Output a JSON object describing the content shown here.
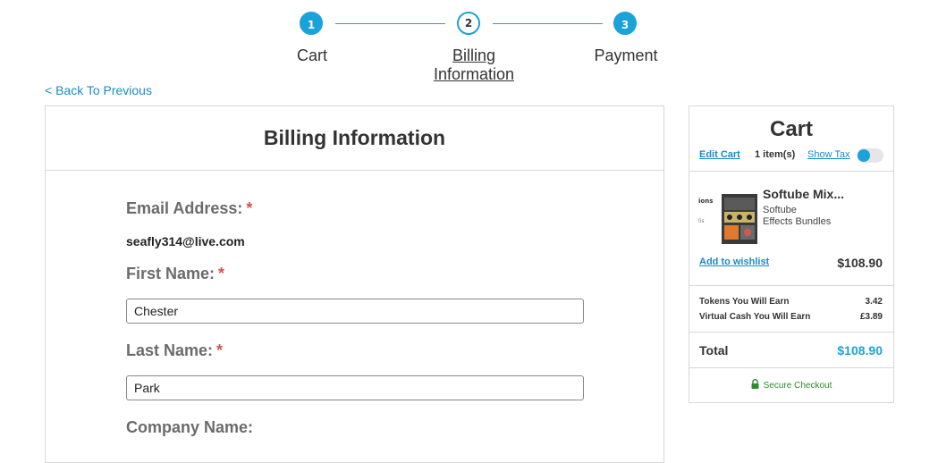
{
  "stepper": {
    "steps": [
      {
        "number": "1",
        "label": "Cart"
      },
      {
        "number": "2",
        "label_line1": "Billing",
        "label_line2": "Information"
      },
      {
        "number": "3",
        "label": "Payment"
      }
    ],
    "current_step": 2
  },
  "back_link": "< Back To Previous",
  "billing": {
    "title": "Billing Information",
    "required_mark": "*",
    "email_label": "Email Address:",
    "email_value": "seafly314@live.com",
    "first_name_label": "First Name:",
    "first_name_value": "Chester",
    "last_name_label": "Last Name:",
    "last_name_value": "Park",
    "company_label": "Company Name:"
  },
  "cart": {
    "title": "Cart",
    "edit_cart": "Edit Cart",
    "item_count": "1 item(s)",
    "show_tax": "Show Tax",
    "show_tax_on": true,
    "item": {
      "name": "Softube Mix...",
      "brand": "Softube",
      "category": "Effects Bundles",
      "price": "$108.90",
      "add_to_wishlist": "Add to wishlist"
    },
    "tokens_label": "Tokens You Will Earn",
    "tokens_value": "3.42",
    "virtual_cash_label": "Virtual Cash You Will Earn",
    "virtual_cash_value": "£3.89",
    "total_label": "Total",
    "total_value": "$108.90",
    "secure_checkout": "Secure Checkout"
  },
  "colors": {
    "accent": "#1aa3d9",
    "link": "#1a8bc4",
    "required": "#d9534f",
    "secure": "#2e8b2e"
  }
}
